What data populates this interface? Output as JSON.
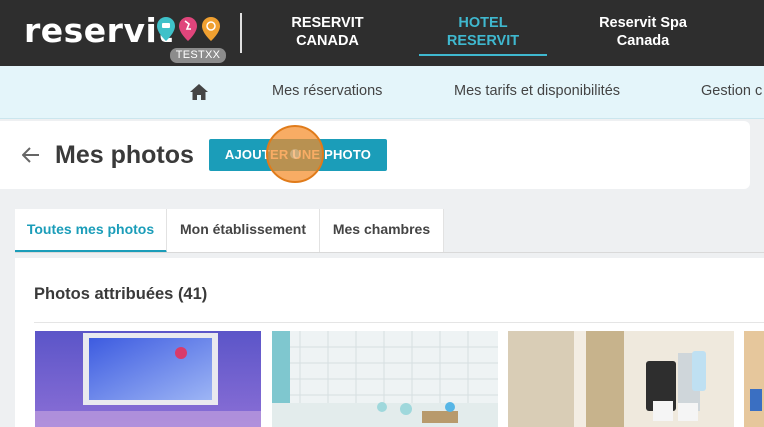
{
  "brand": {
    "logo_text": "reservit",
    "environment_badge": "TESTXX",
    "pin_colors": [
      "#3fc1c9",
      "#e0457b",
      "#f0a030"
    ]
  },
  "hotel_tabs": [
    {
      "line1": "RESERVIT",
      "line2": "CANADA",
      "active": false
    },
    {
      "line1": "HOTEL",
      "line2": "RESERVIT",
      "active": true
    },
    {
      "line1": "Reservit Spa",
      "line2": "Canada",
      "active": false
    }
  ],
  "main_nav": {
    "home_icon": "home-icon",
    "items": [
      "Mes réservations",
      "Mes tarifs et disponibilités",
      "Gestion c"
    ]
  },
  "page": {
    "back_icon": "arrow-left-icon",
    "title": "Mes photos",
    "add_button": "AJOUTER UNE PHOTO"
  },
  "tabs": [
    {
      "label": "Toutes mes photos",
      "active": true
    },
    {
      "label": "Mon établissement",
      "active": false
    },
    {
      "label": "Mes chambres",
      "active": false
    }
  ],
  "gallery": {
    "section_title": "Photos attribuées (41)",
    "photos": [
      "room-painting-photo",
      "spa-bathtub-photo",
      "coffee-corner-photo",
      "room-partial-photo"
    ]
  },
  "colors": {
    "accent": "#1b9db9",
    "topbar": "#2e2e2e",
    "click_marker": "#f58c28"
  }
}
